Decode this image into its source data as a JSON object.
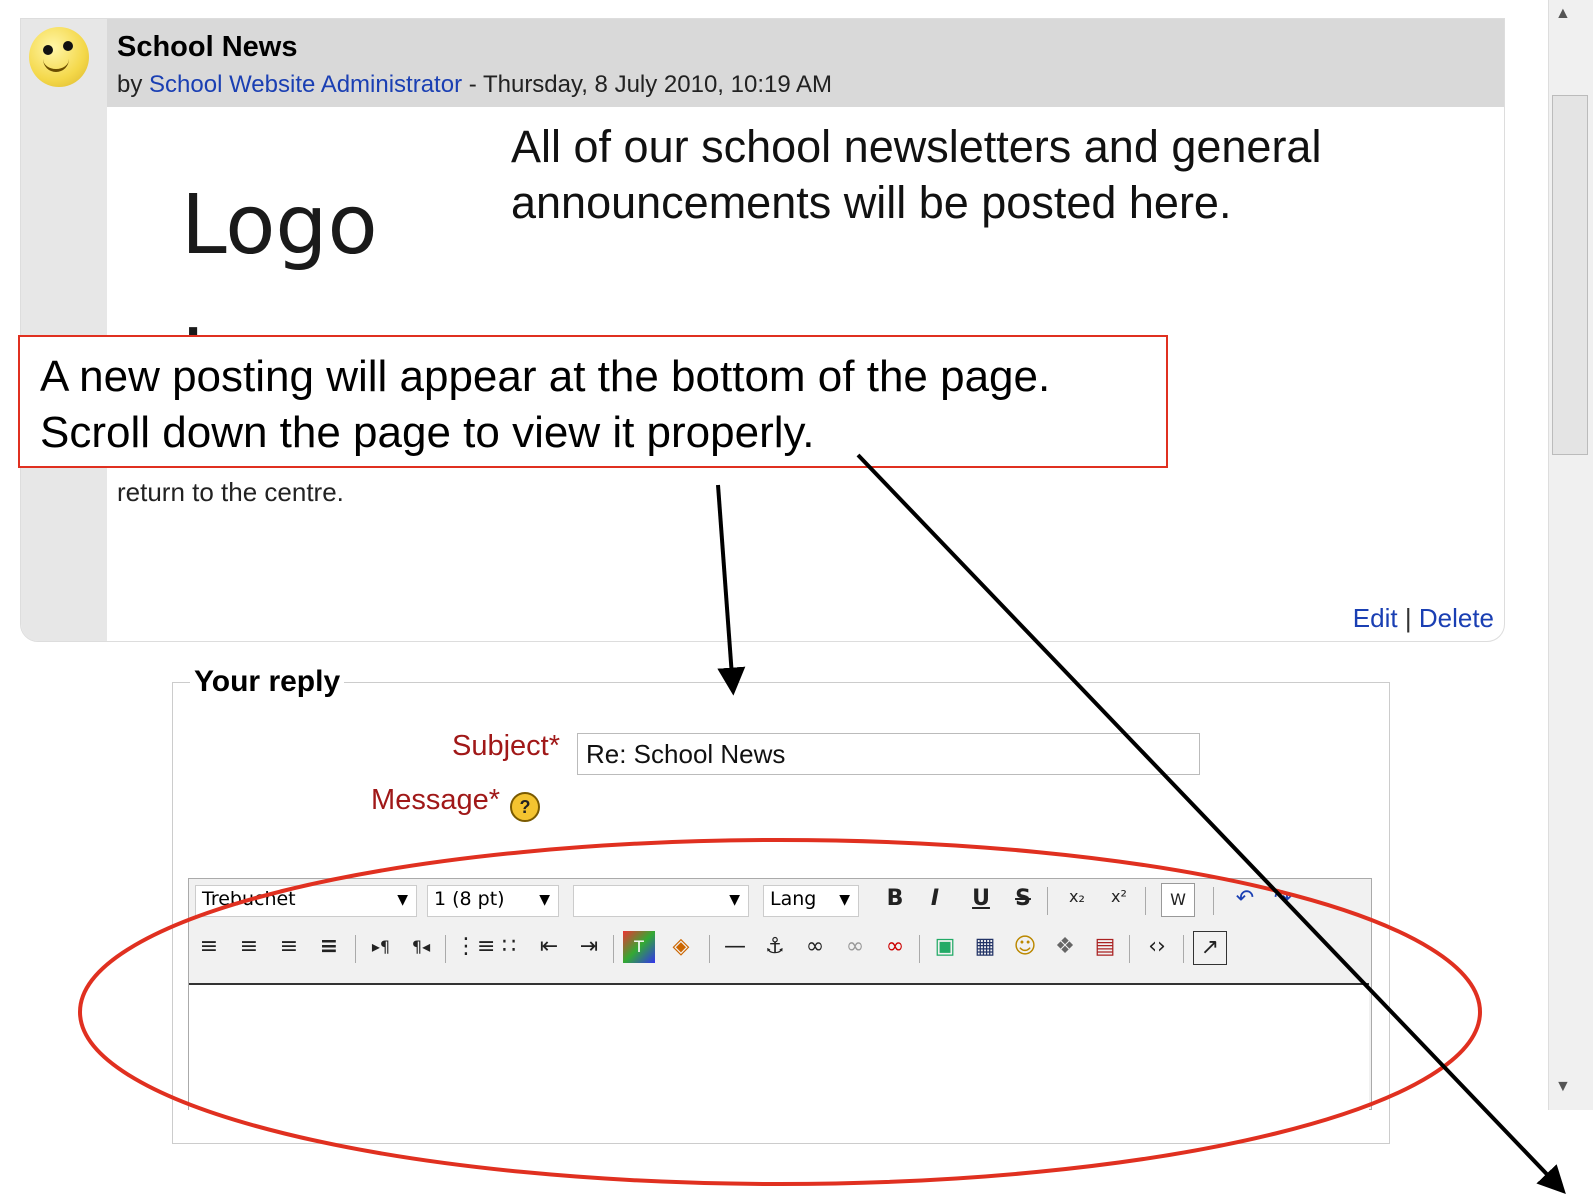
{
  "post": {
    "title": "School News",
    "by_prefix": "by",
    "author": "School Website Administrator",
    "date": " - Thursday, 8 July 2010, 10:19 AM",
    "image_text": "Logo Icon",
    "announcement": "All of our school newsletters and general announcements will be posted here.",
    "partial_text": "return to the centre.",
    "edit_label": "Edit",
    "separator": "|",
    "delete_label": "Delete"
  },
  "reply": {
    "legend": "Your reply",
    "subject_label": "Subject*",
    "subject_value": "Re: School News",
    "message_label": "Message*",
    "help_glyph": "?"
  },
  "editor": {
    "font_family": "Trebuchet",
    "font_size": "1 (8 pt)",
    "paragraph": "",
    "lang": "Lang"
  },
  "callout": {
    "line1": "A new posting will appear at the bottom of the page.",
    "line2": "Scroll down the page to view it properly."
  },
  "colors": {
    "annotation_red": "#e03020",
    "link_blue": "#1a3fb3",
    "required_label": "#a01818"
  }
}
